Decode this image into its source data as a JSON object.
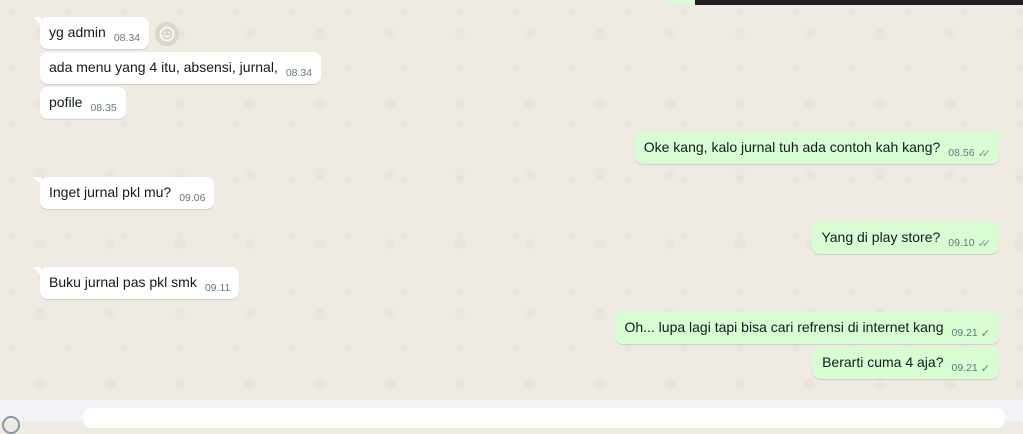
{
  "colors": {
    "chat_background": "#efeae2",
    "incoming_bubble": "#ffffff",
    "outgoing_bubble": "#d9fdd3",
    "tick_read": "#53bdeb",
    "tick_sent": "#667781",
    "time_text": "#667781"
  },
  "messages": [
    {
      "direction": "in",
      "text": "yg admin",
      "time": "08.34",
      "status": ""
    },
    {
      "direction": "in",
      "text": "ada menu yang 4 itu, absensi, jurnal,",
      "time": "08.34",
      "status": ""
    },
    {
      "direction": "in",
      "text": "pofile",
      "time": "08.35",
      "status": ""
    },
    {
      "direction": "out",
      "text": "Oke kang, kalo jurnal tuh ada contoh kah kang?",
      "time": "08.56",
      "status": "read",
      "ticks": "✓✓"
    },
    {
      "direction": "in",
      "text": "Inget jurnal pkl mu?",
      "time": "09.06",
      "status": ""
    },
    {
      "direction": "out",
      "text": "Yang di play store?",
      "time": "09.10",
      "status": "read",
      "ticks": "✓✓"
    },
    {
      "direction": "in",
      "text": "Buku jurnal pas pkl smk",
      "time": "09.11",
      "status": ""
    },
    {
      "direction": "out",
      "text": "Oh... lupa lagi tapi bisa cari refrensi di internet kang",
      "time": "09.21",
      "status": "sent",
      "ticks": "✓"
    },
    {
      "direction": "out",
      "text": "Berarti cuma 4 aja?",
      "time": "09.21",
      "status": "sent",
      "ticks": "✓"
    }
  ],
  "reaction_button": {
    "icon": "smiley-icon"
  },
  "composer": {
    "icon": "emoji-icon",
    "input_value": ""
  }
}
